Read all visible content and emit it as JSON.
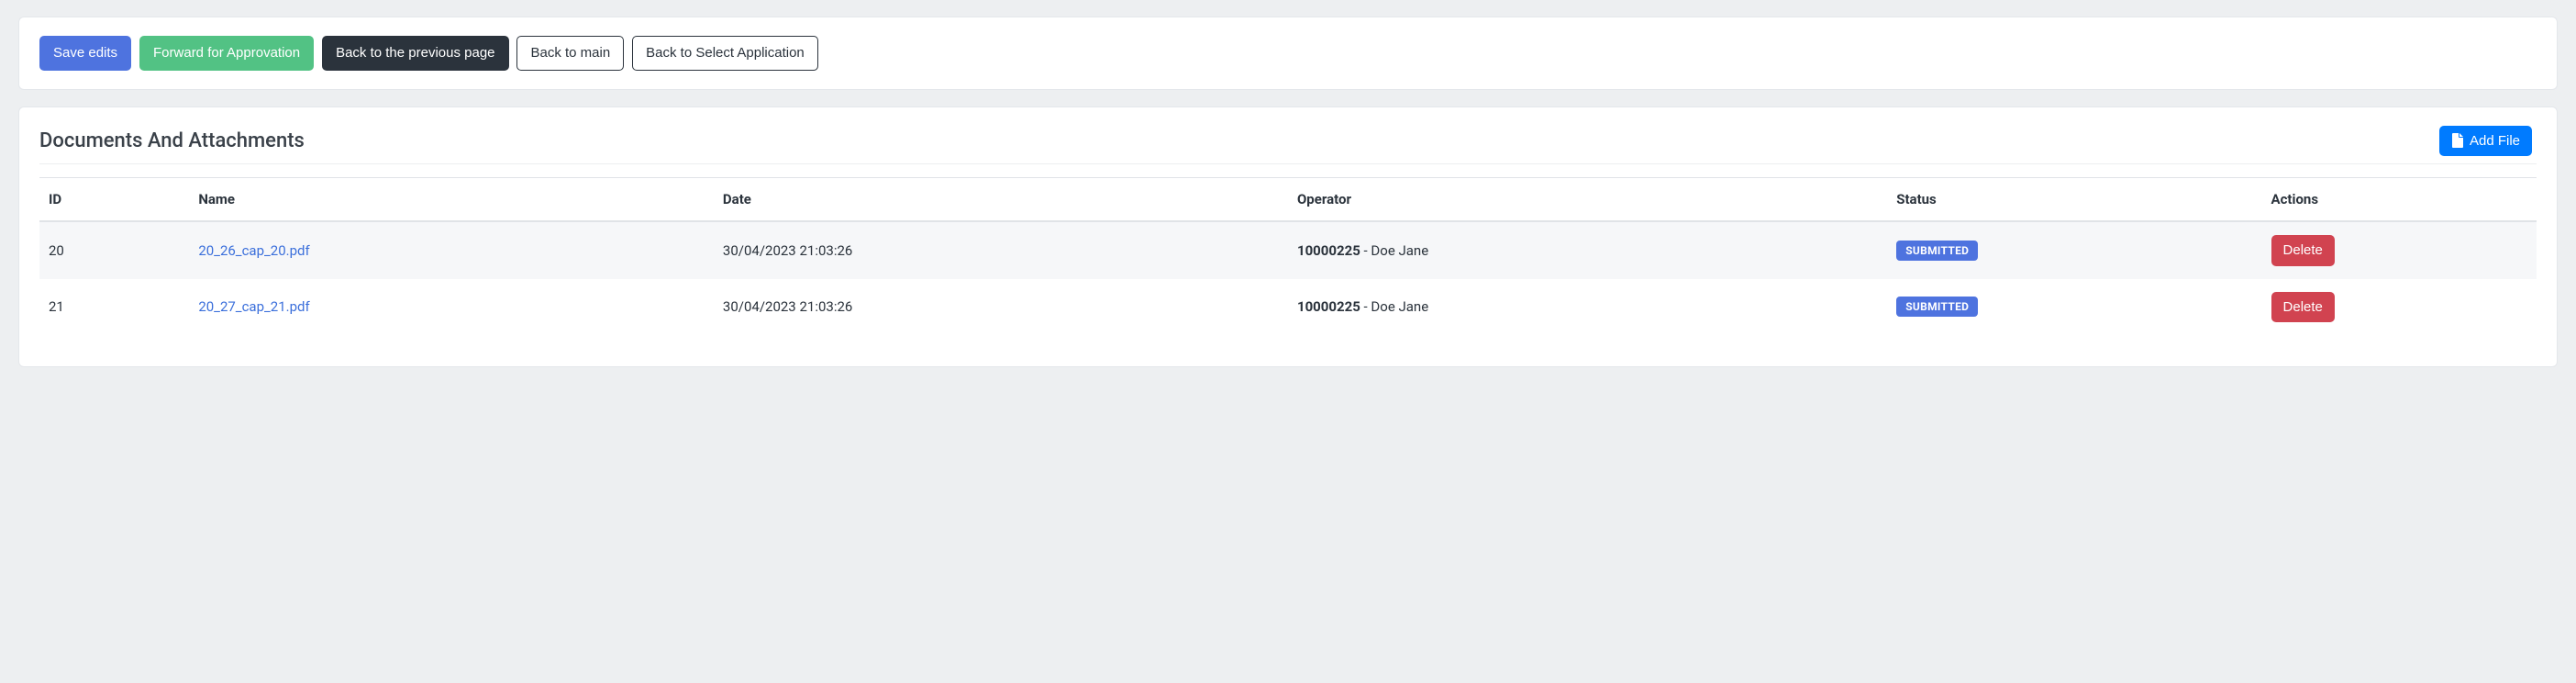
{
  "toolbar": {
    "save_label": "Save edits",
    "forward_label": "Forward for Approvation",
    "back_prev_label": "Back to the previous page",
    "back_main_label": "Back to main",
    "back_select_label": "Back to Select Application"
  },
  "docs": {
    "section_title": "Documents And Attachments",
    "add_file_label": "Add File",
    "columns": {
      "id": "ID",
      "name": "Name",
      "date": "Date",
      "operator": "Operator",
      "status": "Status",
      "actions": "Actions"
    },
    "rows": [
      {
        "id": "20",
        "name": "20_26_cap_20.pdf",
        "date": "30/04/2023 21:03:26",
        "operator_code": "10000225",
        "operator_sep": " - ",
        "operator_name": "Doe Jane",
        "status": "SUBMITTED",
        "action_label": "Delete"
      },
      {
        "id": "21",
        "name": "20_27_cap_21.pdf",
        "date": "30/04/2023 21:03:26",
        "operator_code": "10000225",
        "operator_sep": " - ",
        "operator_name": "Doe Jane",
        "status": "SUBMITTED",
        "action_label": "Delete"
      }
    ]
  },
  "colors": {
    "primary": "#4e73df",
    "success": "#52c284",
    "dark": "#2b333c",
    "danger": "#d14350",
    "info": "#007bff",
    "page_bg": "#edeff1",
    "row_stripe": "#f6f7f9"
  }
}
